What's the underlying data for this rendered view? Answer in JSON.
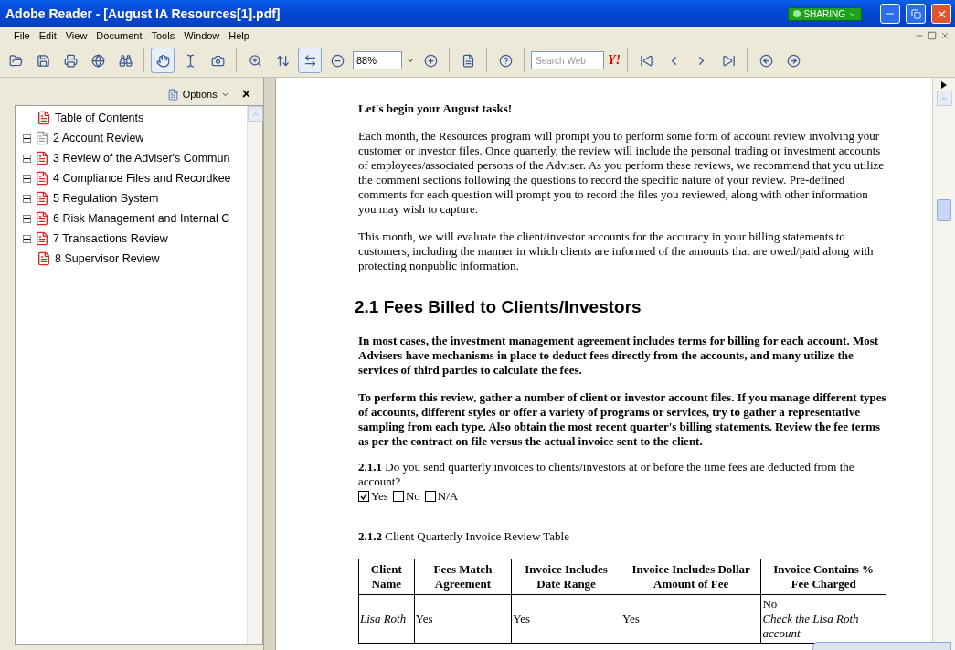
{
  "window": {
    "title": "Adobe Reader - [August IA Resources[1].pdf]",
    "sharing": "SHARING"
  },
  "menu": [
    "File",
    "Edit",
    "View",
    "Document",
    "Tools",
    "Window",
    "Help"
  ],
  "toolbar": {
    "zoom": "88%",
    "search": {
      "placeholder": "Search Web"
    },
    "search_logo": "Y!"
  },
  "panel": {
    "options": "Options",
    "close": "×",
    "items": [
      {
        "label": "Table of Contents",
        "kind": "page",
        "expandable": false
      },
      {
        "label": "2 Account Review",
        "kind": "blank",
        "expandable": true
      },
      {
        "label": "3 Review of the Adviser's Commun",
        "kind": "page",
        "expandable": true
      },
      {
        "label": "4 Compliance Files and Recordkee",
        "kind": "page",
        "expandable": true
      },
      {
        "label": "5 Regulation System",
        "kind": "page",
        "expandable": true
      },
      {
        "label": "6 Risk Management and Internal C",
        "kind": "page",
        "expandable": true
      },
      {
        "label": "7 Transactions Review",
        "kind": "page",
        "expandable": true
      },
      {
        "label": "8 Supervisor Review",
        "kind": "page",
        "expandable": false
      }
    ]
  },
  "document": {
    "blocks": [
      {
        "kind": "lead",
        "text": "Let's begin your August tasks!"
      },
      {
        "kind": "para",
        "text": "Each month, the Resources program will prompt you to perform some form of account review involving your customer or investor files. Once quarterly, the review will include the personal trading or investment accounts of employees/associated persons of the Adviser. As you perform these reviews, we recommend that you utilize the comment sections following the questions to record the specific nature of your review. Pre-defined comments for each question will prompt you to record the files you reviewed, along with other information you may wish to capture."
      },
      {
        "kind": "para",
        "text": "This month, we will evaluate the client/investor accounts for the accuracy in your billing statements to customers, including the manner in which clients are informed of the amounts that are owed/paid along with protecting nonpublic information."
      },
      {
        "kind": "heading",
        "text": "2.1 Fees Billed to Clients/Investors"
      },
      {
        "kind": "bold",
        "text": "In most cases, the investment management agreement includes terms for billing for each account. Most Advisers have mechanisms in place to deduct fees directly from the accounts, and many utilize the services of third parties to calculate the fees."
      },
      {
        "kind": "bold",
        "text": "To perform this review, gather a number of client or investor account files. If you manage different types of accounts, different styles or offer a variety of programs or services, try to gather a representative sampling from each type. Also obtain the most recent quarter's billing statements. Review the fee terms as per the contract on file versus the actual invoice sent to the client."
      }
    ],
    "question": {
      "text": "**2.1.1** Do you send quarterly invoices to clients/investors at or before the time fees are deducted from the account?",
      "options": [
        {
          "label": "Yes",
          "checked": true
        },
        {
          "label": "No",
          "checked": false
        },
        {
          "label": "N/A",
          "checked": false
        }
      ]
    },
    "table_caption": "**2.1.2** Client Quarterly Invoice Review Table",
    "table": {
      "columns": [
        "Client Name",
        "Fees Match Agreement",
        "Invoice Includes Date Range",
        "Invoice Includes Dollar Amount of Fee",
        "Invoice Contains % Fee Charged"
      ],
      "rows": [
        [
          {
            "text": "Lisa Roth",
            "italic": true
          },
          {
            "text": "Yes"
          },
          {
            "text": "Yes"
          },
          {
            "text": "Yes"
          },
          {
            "text": "No",
            "note": "Check the Lisa Roth account"
          }
        ]
      ]
    }
  }
}
